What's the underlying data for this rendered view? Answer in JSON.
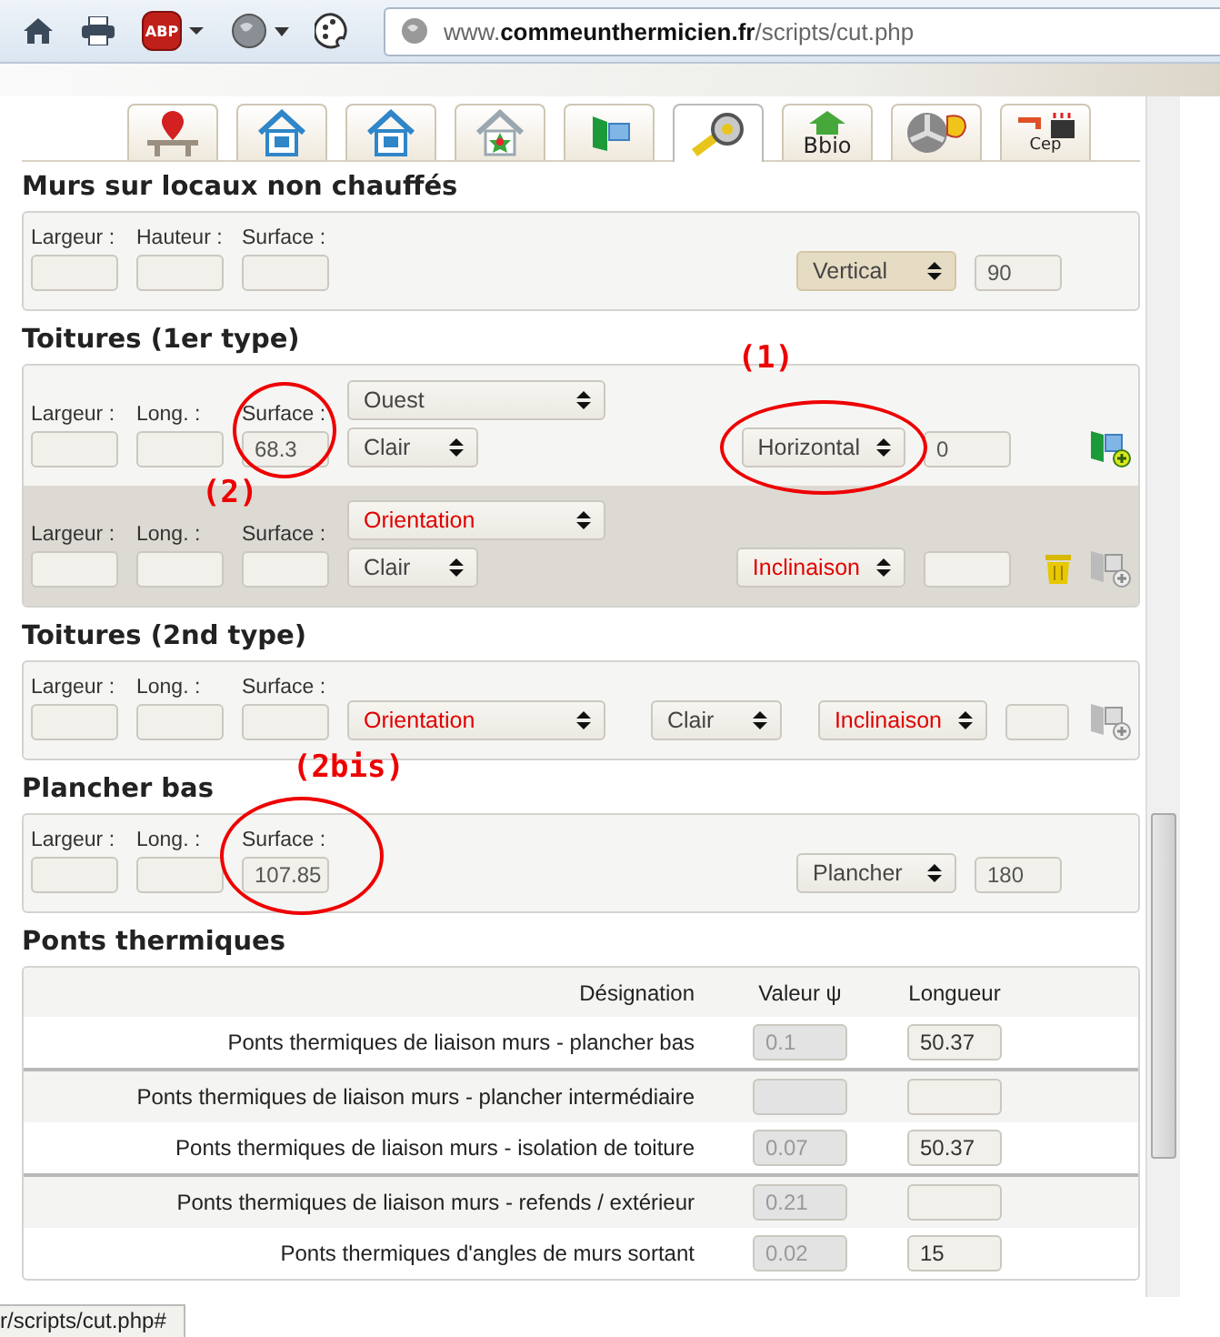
{
  "toolbar": {
    "adblock_label": "ABP",
    "url": "www.**commeunthermicien.fr**/scripts/cut.php"
  },
  "tabs": [
    {
      "kind": "pin",
      "selected": false
    },
    {
      "kind": "house",
      "selected": false
    },
    {
      "kind": "house",
      "selected": false
    },
    {
      "kind": "star",
      "selected": false
    },
    {
      "kind": "window",
      "selected": false
    },
    {
      "kind": "tape",
      "selected": true
    },
    {
      "kind": "roof",
      "label": "Bbio",
      "selected": false
    },
    {
      "kind": "fan",
      "selected": false
    },
    {
      "kind": "faucet",
      "label": "Cep",
      "selected": false
    }
  ],
  "sections": [
    {
      "title": "Murs sur locaux non chauffés",
      "rows": [
        {
          "kind": "simple",
          "shaded": false,
          "fields": [
            {
              "label": "Largeur :"
            },
            {
              "label": "Hauteur :"
            },
            {
              "label": "Surface :"
            }
          ],
          "tilt": {
            "value": "Vertical",
            "highlighted": true,
            "unset": false
          },
          "angle": "90",
          "actions": []
        }
      ]
    },
    {
      "title": "Toitures (1er type)",
      "rows": [
        {
          "kind": "stacked",
          "shaded": false,
          "fields": [
            {
              "label": "Largeur :"
            },
            {
              "label": "Long. :"
            },
            {
              "label": "Surface :",
              "value": "68.3",
              "annotation": {
                "label": "(2)"
              }
            }
          ],
          "orientation": {
            "value": "Ouest",
            "unset": false
          },
          "covering": {
            "value": "Clair",
            "unset": false
          },
          "tilt": {
            "value": "Horizontal",
            "highlighted": false,
            "unset": false,
            "annotation": {
              "label": "(1)"
            }
          },
          "angle": "0",
          "actions": [
            {
              "kind": "add",
              "disabled": false
            }
          ]
        },
        {
          "kind": "stacked",
          "shaded": true,
          "fields": [
            {
              "label": "Largeur :"
            },
            {
              "label": "Long. :"
            },
            {
              "label": "Surface :"
            }
          ],
          "orientation": {
            "value": "Orientation",
            "unset": true
          },
          "covering": {
            "value": "Clair",
            "unset": false
          },
          "tilt": {
            "value": "Inclinaison",
            "highlighted": false,
            "unset": true
          },
          "actions": [
            {
              "kind": "trash",
              "disabled": false
            },
            {
              "kind": "add",
              "disabled": true
            }
          ]
        }
      ]
    },
    {
      "title": "Toitures (2nd type)",
      "rows": [
        {
          "kind": "inline",
          "shaded": false,
          "fields": [
            {
              "label": "Largeur :"
            },
            {
              "label": "Long. :"
            },
            {
              "label": "Surface :"
            }
          ],
          "orientation": {
            "value": "Orientation",
            "unset": true
          },
          "covering": {
            "value": "Clair",
            "unset": false
          },
          "tilt": {
            "value": "Inclinaison",
            "highlighted": false,
            "unset": true
          },
          "actions": [
            {
              "kind": "add",
              "disabled": true
            }
          ]
        }
      ]
    },
    {
      "title": "Plancher bas",
      "rows": [
        {
          "kind": "simple",
          "shaded": false,
          "fields": [
            {
              "label": "Largeur :"
            },
            {
              "label": "Long. :"
            },
            {
              "label": "Surface :",
              "value": "107.85",
              "annotation": {
                "label": "(2bis)"
              }
            }
          ],
          "tilt": {
            "value": "Plancher",
            "highlighted": false,
            "unset": false
          },
          "angle": "180",
          "actions": []
        }
      ]
    }
  ],
  "thermal_bridges": {
    "title": "Ponts thermiques",
    "columns": [
      "Désignation",
      "Valeur ψ",
      "Longueur"
    ],
    "groups": [
      {
        "rows": [
          {
            "designation": "Ponts thermiques de liaison murs - plancher bas",
            "value": "0.1",
            "length": "50.37"
          }
        ]
      },
      {
        "rows": [
          {
            "designation": "Ponts thermiques de liaison murs - plancher intermédiaire"
          },
          {
            "designation": "Ponts thermiques de liaison murs - isolation de toiture",
            "value": "0.07",
            "length": "50.37"
          }
        ]
      },
      {
        "rows": [
          {
            "designation": "Ponts thermiques de liaison murs - refends / extérieur",
            "value": "0.21"
          },
          {
            "designation": "Ponts thermiques d'angles de murs sortant",
            "value": "0.02",
            "length": "15"
          }
        ]
      }
    ]
  },
  "status_bar": "r/scripts/cut.php#"
}
